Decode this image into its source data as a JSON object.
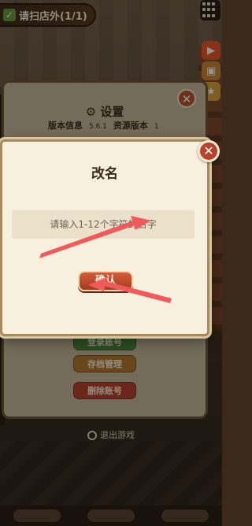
{
  "hud": {
    "task_label": "请扫店外",
    "task_progress": "(1/1)"
  },
  "settings": {
    "title": "设置",
    "version_label": "版本信息",
    "version_value": "5.6.1",
    "resource_label": "资源版本",
    "resource_value": "1",
    "buttons": {
      "switch_account": "登录账号",
      "archive": "存档管理",
      "delete_account": "删除账号"
    },
    "exit_label": "退出游戏"
  },
  "dialog": {
    "title": "改名",
    "close_symbol": "✕",
    "input_placeholder": "请输入1-12个字符的名字",
    "confirm_label": "确认"
  },
  "annotation_color": "#f05a5a"
}
